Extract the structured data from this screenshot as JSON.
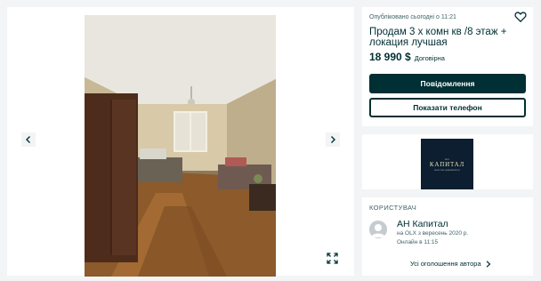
{
  "gallery": {
    "photo_alt": "apartment room photo",
    "prev_icon": "chevron-left-icon",
    "next_icon": "chevron-right-icon",
    "expand_icon": "fullscreen-icon"
  },
  "listing": {
    "published": "Опубліковано сьогодні о 11:21",
    "title": "Продам 3 х комн кв /8 этаж + локация лучшая",
    "price": "18 990 $",
    "negotiable": "Договірна",
    "favorite_icon": "heart-icon",
    "message_button": "Повідомлення",
    "phone_button": "Показати телефон"
  },
  "logo": {
    "small_text": "АН",
    "name": "КАПИТАЛ",
    "sub_text": "агентство недвижимости"
  },
  "user": {
    "heading": "КОРИСТУВАЧ",
    "name": "АН Капитал",
    "since": "на OLX з вересень 2020 р.",
    "online": "Онлайн в 11:15",
    "all_ads": "Усі оголошення автора",
    "avatar_icon": "user-avatar-icon",
    "chevron_icon": "chevron-right-icon"
  },
  "colors": {
    "primary": "#002f34",
    "background": "#f2f4f5",
    "logo_bg": "#0c1e2f"
  }
}
